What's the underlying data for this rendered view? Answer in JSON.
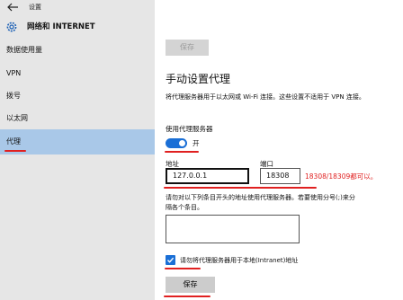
{
  "window": {
    "title": "设置"
  },
  "header": {
    "title": "网络和 INTERNET"
  },
  "sidebar": {
    "items": [
      {
        "label": "数据使用量"
      },
      {
        "label": "VPN"
      },
      {
        "label": "拨号"
      },
      {
        "label": "以太网"
      },
      {
        "label": "代理",
        "selected": true
      }
    ]
  },
  "main": {
    "top_save_label": "保存",
    "heading": "手动设置代理",
    "description": "将代理服务器用于以太网或 Wi-Fi 连接。这些设置不适用于 VPN 连接。",
    "use_proxy_label": "使用代理服务器",
    "toggle_state_label": "开",
    "toggle_on": true,
    "address_label": "地址",
    "address_value": "127.0.0.1",
    "port_label": "端口",
    "port_value": "18308",
    "port_annotation": "18308/18309都可以。",
    "exceptions_text_line1": "请勿对以下列条目开头的地址使用代理服务器。若要使用分号(;)来分",
    "exceptions_text_line2": "隔各个条目。",
    "exceptions_value": "",
    "bypass_local_label": "请勿将代理服务器用于本地(Intranet)地址",
    "bypass_local_checked": true,
    "save_label": "保存"
  },
  "colors": {
    "accent": "#1a6fd6",
    "annotation": "#e02020",
    "sidebar_bg": "#e6e6e6",
    "sidebar_selected": "#a9c8e8"
  }
}
